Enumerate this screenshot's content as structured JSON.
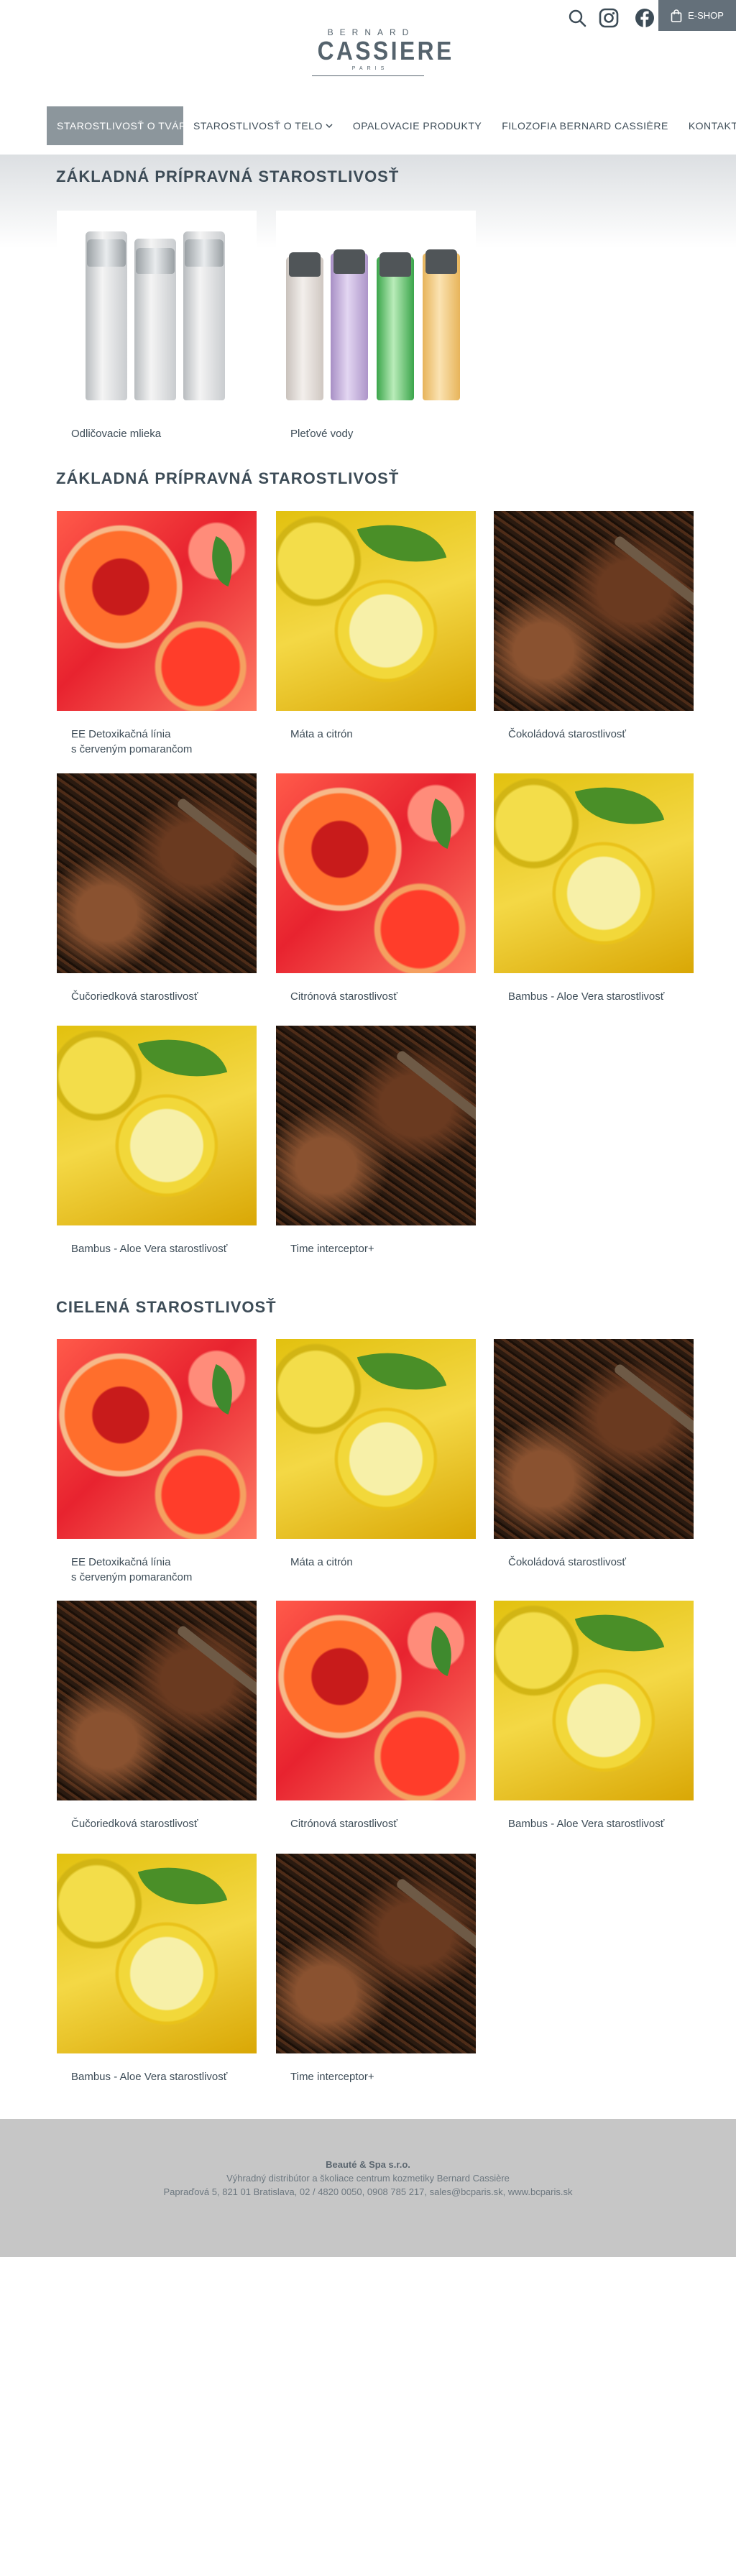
{
  "header": {
    "logo": {
      "line1": "BERNARD",
      "line2": "CASSIERE",
      "line3": "PARIS"
    },
    "icons": [
      "search-icon",
      "instagram-icon",
      "facebook-icon"
    ],
    "eshop_label": "E-SHOP"
  },
  "nav": {
    "items": [
      {
        "label": "STAROSTLIVOSŤ O TVÁR",
        "active": true,
        "dropdown": true
      },
      {
        "label": "STAROSTLIVOSŤ O TELO",
        "active": false,
        "dropdown": true
      },
      {
        "label": "OPALOVACIE PRODUKTY",
        "active": false,
        "dropdown": false
      },
      {
        "label": "FILOZOFIA BERNARD CASSIÈRE",
        "active": false,
        "dropdown": false
      },
      {
        "label": "KONTAKTY",
        "active": false,
        "dropdown": false
      }
    ]
  },
  "sections": [
    {
      "title": "ZÁKLADNÁ PRÍPRAVNÁ STAROSTLIVOSŤ",
      "items": [
        {
          "caption": "Odličovacie mlieka",
          "image": "milk-bottles"
        },
        {
          "caption": "Pleťové vody",
          "image": "toner-bottles"
        }
      ]
    },
    {
      "title": "ZÁKLADNÁ PRÍPRAVNÁ STAROSTLIVOSŤ",
      "items": [
        {
          "caption": "EE Detoxikačná línia\ns červeným pomarančom",
          "image": "orange"
        },
        {
          "caption": "Máta a citrón",
          "image": "lemon"
        },
        {
          "caption": "Čokoládová starostlivosť",
          "image": "chocolate"
        },
        {
          "caption": "Čučoriedková starostlivosť",
          "image": "chocolate"
        },
        {
          "caption": "Citrónová starostlivosť",
          "image": "orange"
        },
        {
          "caption": "Bambus - Aloe Vera starostlivosť",
          "image": "lemon"
        },
        {
          "caption": "Bambus - Aloe Vera starostlivosť",
          "image": "lemon"
        },
        {
          "caption": "Time interceptor+",
          "image": "chocolate"
        }
      ]
    },
    {
      "title": "CIELENÁ STAROSTLIVOSŤ",
      "items": [
        {
          "caption": "EE Detoxikačná línia\ns červeným pomarančom",
          "image": "orange"
        },
        {
          "caption": "Máta a citrón",
          "image": "lemon"
        },
        {
          "caption": "Čokoládová starostlivosť",
          "image": "chocolate"
        },
        {
          "caption": "Čučoriedková starostlivosť",
          "image": "chocolate"
        },
        {
          "caption": "Citrónová starostlivosť",
          "image": "orange"
        },
        {
          "caption": "Bambus - Aloe Vera starostlivosť",
          "image": "lemon"
        },
        {
          "caption": "Bambus - Aloe Vera starostlivosť",
          "image": "lemon"
        },
        {
          "caption": "Time interceptor+",
          "image": "chocolate"
        }
      ]
    }
  ],
  "footer": {
    "company": "Beauté & Spa s.r.o.",
    "line2": "Výhradný distribútor a školiace centrum kozmetiky Bernard Cassière",
    "line3": "Papraďová 5, 821 01 Bratislava, 02 / 4820 0050, 0908 785 217, sales@bcparis.sk, www.bcparis.sk"
  },
  "colors": {
    "nav_active_bg": "#8c969c",
    "eshop_bg": "#64707a",
    "text": "#3d4c57",
    "footer_bg": "#c6c6c6"
  }
}
